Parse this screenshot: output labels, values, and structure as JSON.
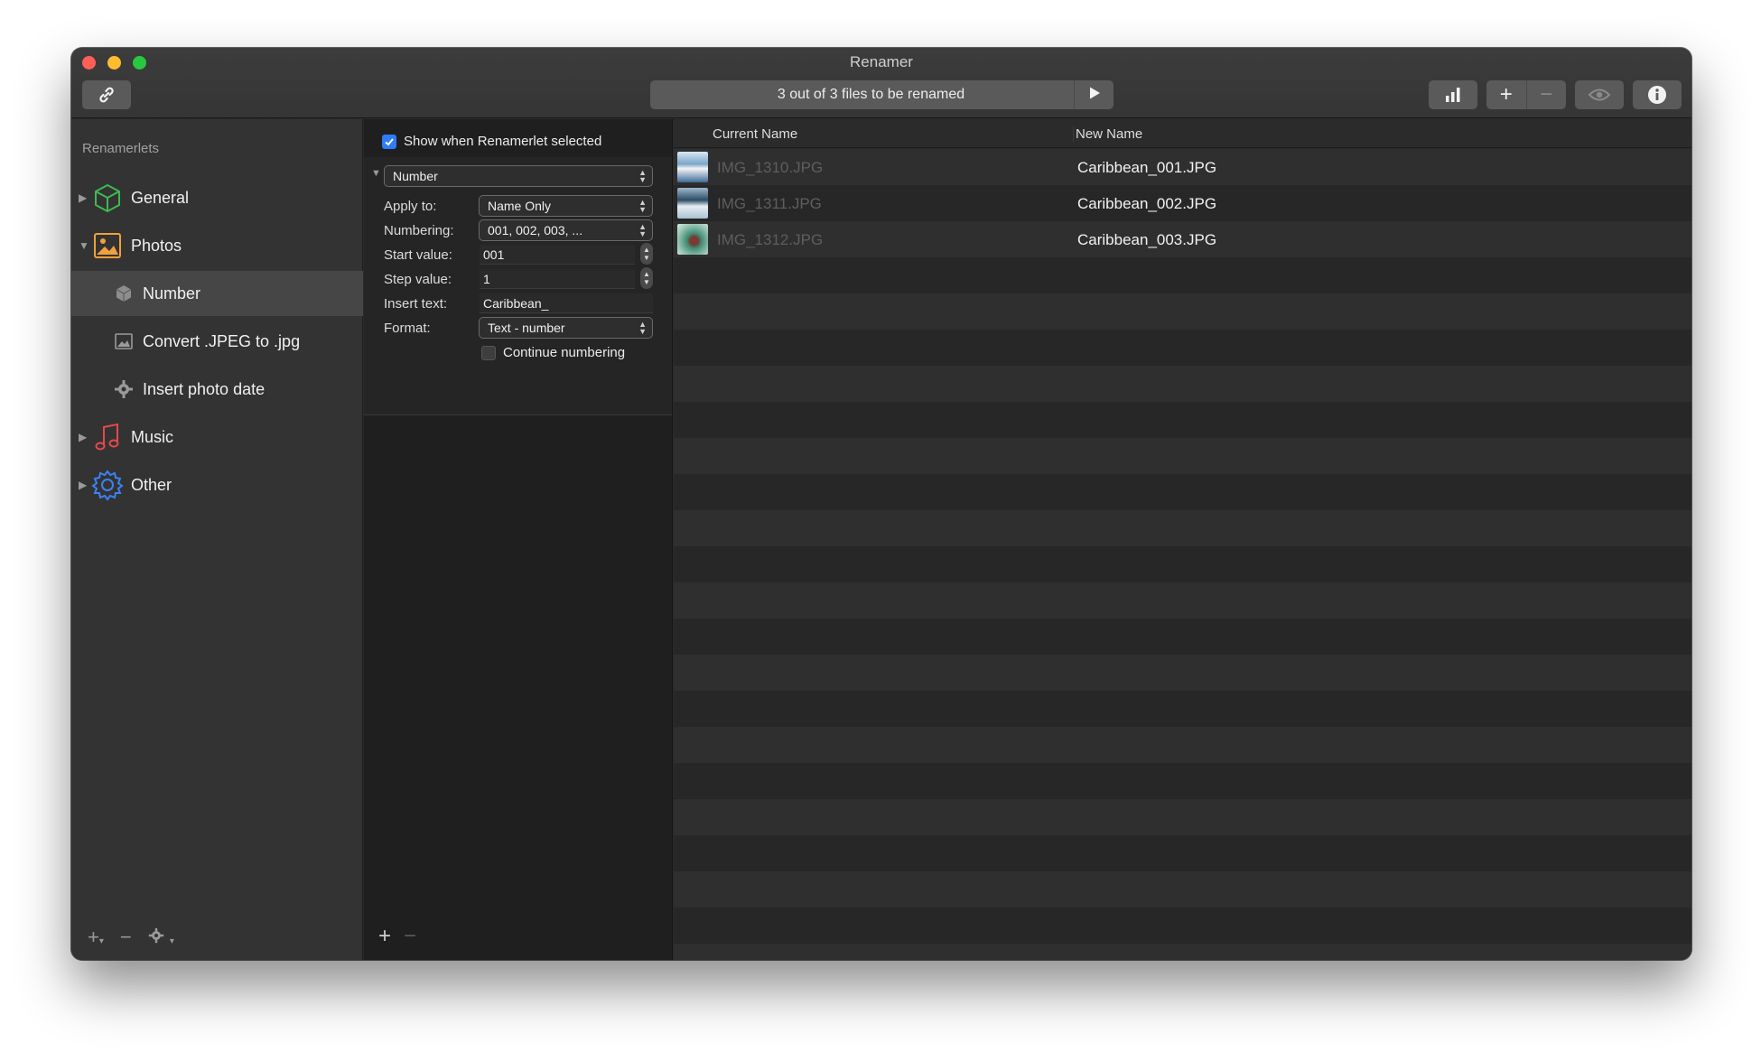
{
  "window": {
    "title": "Renamer",
    "status_text": "3 out of 3 files to be renamed"
  },
  "toolbar": {
    "link_icon": "link-icon",
    "play_icon": "play-icon",
    "chart_icon": "bar-chart-icon",
    "add_label": "+",
    "remove_label": "−",
    "eye_icon": "eye-icon",
    "info_icon": "info-icon"
  },
  "sidebar": {
    "heading": "Renamerlets",
    "items": [
      {
        "label": "General",
        "icon": "cube-icon",
        "color": "#3fb950"
      },
      {
        "label": "Photos",
        "icon": "photo-icon",
        "color": "#f0a03c"
      },
      {
        "label": "Number",
        "icon": "cube-small-icon"
      },
      {
        "label": "Convert .JPEG to .jpg",
        "icon": "image-small-icon"
      },
      {
        "label": "Insert photo date",
        "icon": "gear-small-icon"
      },
      {
        "label": "Music",
        "icon": "music-note-icon",
        "color": "#e5484d"
      },
      {
        "label": "Other",
        "icon": "gear-icon",
        "color": "#3b82f6"
      }
    ],
    "footer": {
      "add": "+",
      "remove": "−"
    }
  },
  "panel": {
    "show_when_selected": {
      "label": "Show when Renamerlet selected",
      "checked": true
    },
    "renamerlet_type": "Number",
    "fields": {
      "apply_to": {
        "label": "Apply to:",
        "value": "Name Only"
      },
      "numbering": {
        "label": "Numbering:",
        "value": "001, 002, 003, ..."
      },
      "start_value": {
        "label": "Start value:",
        "value": "001"
      },
      "step_value": {
        "label": "Step value:",
        "value": "1"
      },
      "insert_text": {
        "label": "Insert text:",
        "value": "Caribbean_"
      },
      "format": {
        "label": "Format:",
        "value": "Text - number"
      }
    },
    "continue_numbering": {
      "label": "Continue numbering",
      "checked": false
    },
    "footer": {
      "add": "+",
      "remove": "−"
    }
  },
  "filelist": {
    "columns": [
      "Current Name",
      "New Name"
    ],
    "rows": [
      {
        "current": "IMG_1310.JPG",
        "new": "Caribbean_001.JPG"
      },
      {
        "current": "IMG_1311.JPG",
        "new": "Caribbean_002.JPG"
      },
      {
        "current": "IMG_1312.JPG",
        "new": "Caribbean_003.JPG"
      }
    ]
  },
  "colors": {
    "accent": "#2f7cf6",
    "traffic_red": "#fe5f57",
    "traffic_yellow": "#febc2e",
    "traffic_green": "#28c840"
  }
}
